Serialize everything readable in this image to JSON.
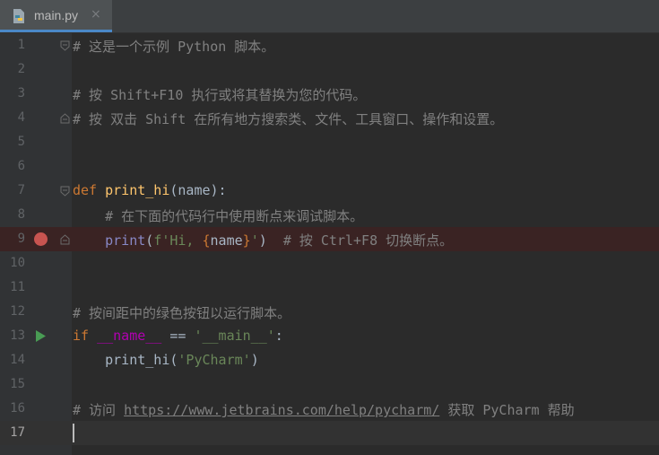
{
  "tab": {
    "title": "main.py",
    "close_glyph": "×",
    "icon": "python-file-icon"
  },
  "gutter": {
    "breakpoint_color": "#c75450",
    "run_icon": "run-triangle-icon",
    "run_color": "#499c54"
  },
  "lines": [
    {
      "num": "1",
      "text": "# 这是一个示例 Python 脚本。"
    },
    {
      "num": "2",
      "text": ""
    },
    {
      "num": "3",
      "text": "# 按 Shift+F10 执行或将其替换为您的代码。"
    },
    {
      "num": "4",
      "text": "# 按 双击 Shift 在所有地方搜索类、文件、工具窗口、操作和设置。"
    },
    {
      "num": "5",
      "text": ""
    },
    {
      "num": "6",
      "text": ""
    },
    {
      "num": "7",
      "text": "def print_hi(name):"
    },
    {
      "num": "8",
      "text": "    # 在下面的代码行中使用断点来调试脚本。"
    },
    {
      "num": "9",
      "text": "    print(f'Hi, {name}')  # 按 Ctrl+F8 切换断点。"
    },
    {
      "num": "10",
      "text": ""
    },
    {
      "num": "11",
      "text": ""
    },
    {
      "num": "12",
      "text": "# 按间距中的绿色按钮以运行脚本。"
    },
    {
      "num": "13",
      "text": "if __name__ == '__main__':"
    },
    {
      "num": "14",
      "text": "    print_hi('PyCharm')"
    },
    {
      "num": "15",
      "text": ""
    },
    {
      "num": "16",
      "text": "# 访问 https://www.jetbrains.com/help/pycharm/ 获取 PyCharm 帮助"
    },
    {
      "num": "17",
      "text": ""
    }
  ],
  "tokens": {
    "l1": "# 这是一个示例 Python 脚本。",
    "l3": "# 按 Shift+F10 执行或将其替换为您的代码。",
    "l4": "# 按 双击 Shift 在所有地方搜索类、文件、工具窗口、操作和设置。",
    "l7": {
      "kw": "def",
      "fn": "print_hi",
      "rest": "(name):"
    },
    "l8": {
      "indent": "    ",
      "cmt": "# 在下面的代码行中使用断点来调试脚本。"
    },
    "l9": {
      "indent": "    ",
      "bi": "print",
      "p1": "(",
      "fprefix": "f'Hi, ",
      "brace_open": "{",
      "var": "name",
      "brace_close": "}",
      "fsuffix": "'",
      "p2": ")",
      "gap": "  ",
      "cmt": "# 按 Ctrl+F8 切换断点。"
    },
    "l12": "# 按间距中的绿色按钮以运行脚本。",
    "l13": {
      "kw": "if",
      "sp": " ",
      "dun": "__name__",
      "op": " == ",
      "str": "'__main__'",
      "colon": ":"
    },
    "l14": {
      "indent": "    ",
      "call": "print_hi",
      "p1": "(",
      "str": "'PyCharm'",
      "p2": ")"
    },
    "l16": {
      "pre": "# 访问 ",
      "link": "https://www.jetbrains.com/help/pycharm/",
      "post": " 获取 PyCharm 帮助"
    }
  }
}
